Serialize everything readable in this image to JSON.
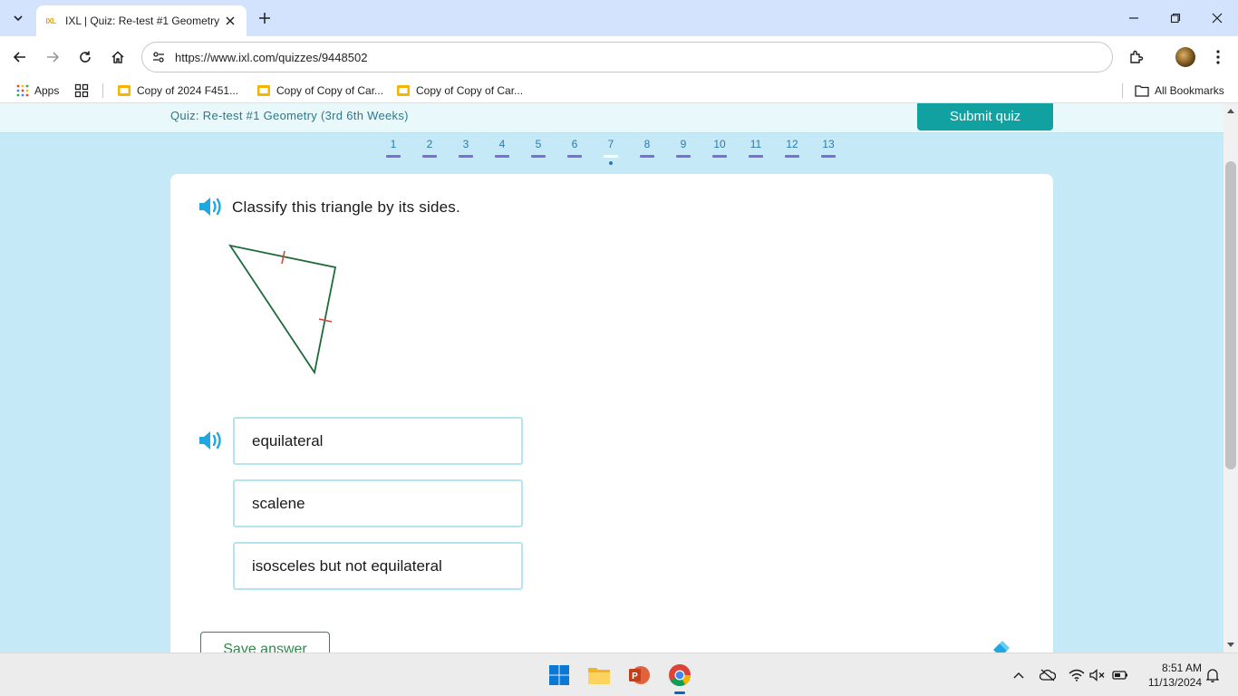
{
  "browser": {
    "tab_title": "IXL | Quiz: Re-test #1 Geometry",
    "favicon_text": "IXL",
    "url": "https://www.ixl.com/quizzes/9448502"
  },
  "bookmarks": {
    "apps_label": "Apps",
    "items": [
      {
        "label": "Copy of 2024 F451..."
      },
      {
        "label": "Copy of Copy of Car..."
      },
      {
        "label": "Copy of Copy of Car..."
      }
    ],
    "all_bookmarks_label": "All Bookmarks"
  },
  "quiz": {
    "title": "Quiz: Re-test #1 Geometry (3rd 6th Weeks)",
    "submit_label": "Submit quiz",
    "questions": [
      "1",
      "2",
      "3",
      "4",
      "5",
      "6",
      "7",
      "8",
      "9",
      "10",
      "11",
      "12",
      "13"
    ],
    "current_question": "7",
    "question_text": "Classify this triangle by its sides.",
    "choices": [
      {
        "label": "equilateral"
      },
      {
        "label": "scalene"
      },
      {
        "label": "isosceles but not equilateral"
      }
    ],
    "save_label": "Save answer"
  },
  "taskbar": {
    "time": "8:51 AM",
    "date": "11/13/2024"
  },
  "colors": {
    "page_bg": "#c6e9f7",
    "accent_teal": "#11a1a1",
    "triangle_stroke": "#1e6b3a",
    "tick_marks": "#e03c3c",
    "speaker_blue": "#1ea7e0"
  }
}
